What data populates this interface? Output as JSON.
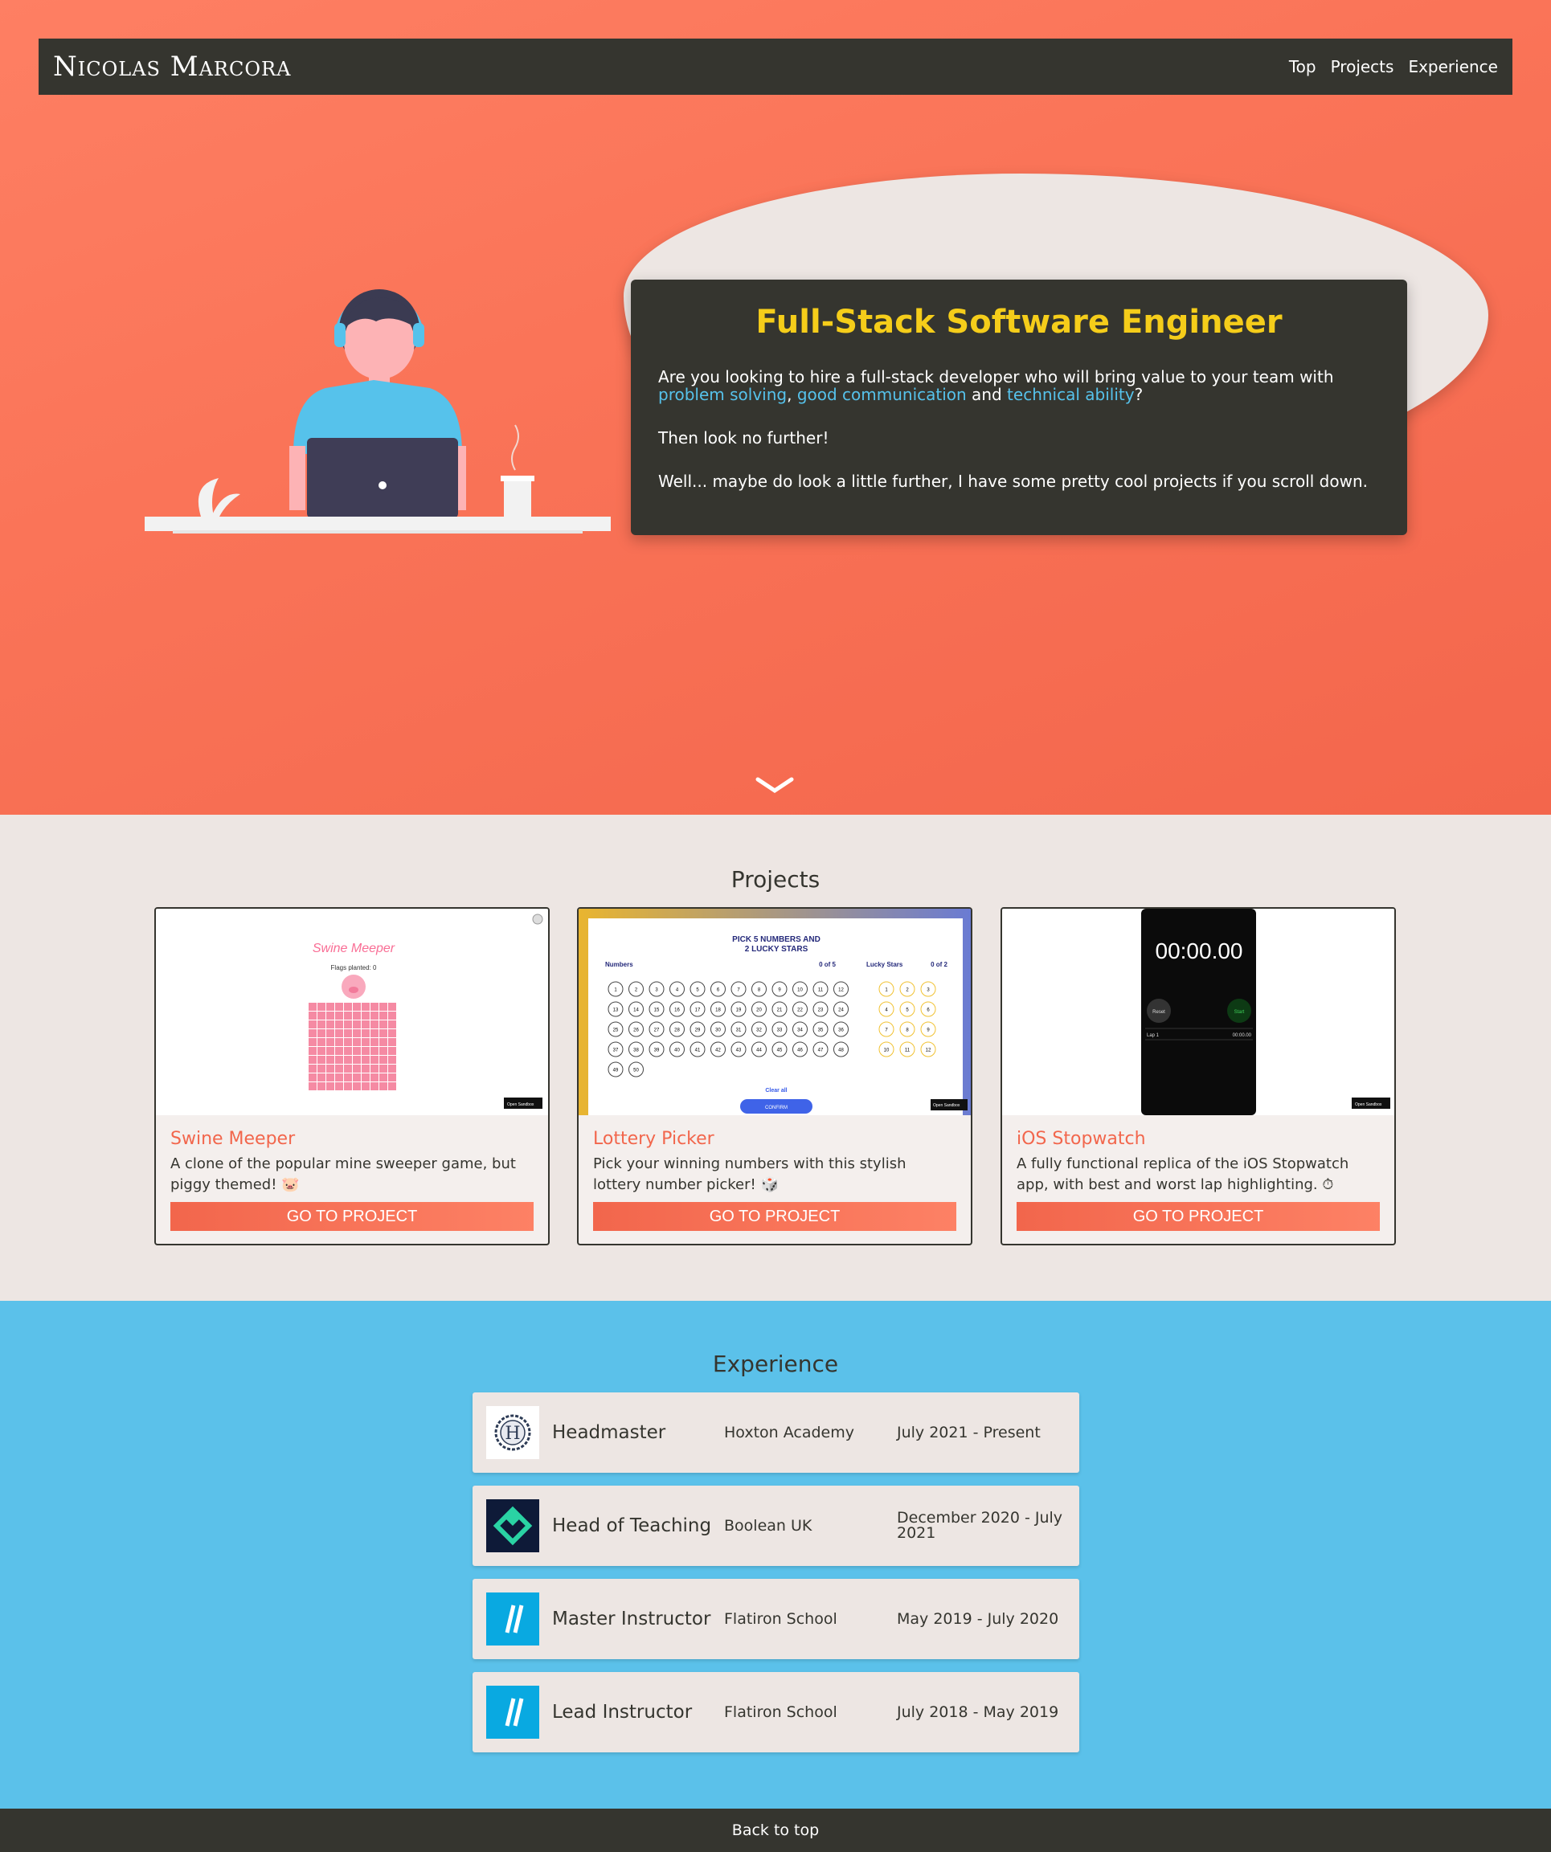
{
  "nav": {
    "brand": "Nicolas Marcora",
    "links": [
      "Top",
      "Projects",
      "Experience"
    ]
  },
  "hero": {
    "title": "Full-Stack Software Engineer",
    "p1_prefix": "Are you looking to hire a full-stack developer who will bring value to your team with ",
    "hl1": "problem solving",
    "sep1": ", ",
    "hl2": "good communication",
    "sep2": " and ",
    "hl3": "technical ability",
    "p1_suffix": "?",
    "p2": "Then look no further!",
    "p3": "Well... maybe do look a little further, I have some pretty cool projects if you scroll down.",
    "colors": {
      "title": "#f5cd1a",
      "highlight": "#56c2eb",
      "card": "#35352f"
    }
  },
  "projects": {
    "title": "Projects",
    "items": [
      {
        "name": "Swine Meeper",
        "desc": "A clone of the popular mine sweeper game, but piggy themed! 🐷",
        "button": "GO TO PROJECT",
        "thumb": {
          "title": "Swine Meeper",
          "subtitle": "Flags planted: 0",
          "badge": "Open Sandbox"
        }
      },
      {
        "name": "Lottery Picker",
        "desc": "Pick your winning numbers with this stylish lottery number picker! 🎲",
        "button": "GO TO PROJECT",
        "thumb": {
          "title1": "PICK 5 NUMBERS AND",
          "title2": "2 LUCKY STARS",
          "numbers_label": "Numbers",
          "numbers_count": "0 of 5",
          "stars_label": "Lucky Stars",
          "stars_count": "0 of 2",
          "clear": "Clear all",
          "confirm": "CONFIRM",
          "badge": "Open Sandbox"
        }
      },
      {
        "name": "iOS Stopwatch",
        "desc": "A fully functional replica of the iOS Stopwatch app, with best and worst lap highlighting. ⏱",
        "button": "GO TO PROJECT",
        "thumb": {
          "time": "00:00.00",
          "reset": "Reset",
          "start": "Start",
          "lap": "Lap 1",
          "lap_time": "00:00.00",
          "badge": "Open Sandbox"
        }
      }
    ]
  },
  "experience": {
    "title": "Experience",
    "items": [
      {
        "role": "Headmaster",
        "org": "Hoxton Academy",
        "dates": "July 2021 - Present",
        "logo": "hoxton-crest-icon"
      },
      {
        "role": "Head of Teaching",
        "org": "Boolean UK",
        "dates": "December 2020 - July 2021",
        "logo": "boolean-diamond-icon"
      },
      {
        "role": "Master Instructor",
        "org": "Flatiron School",
        "dates": "May 2019 - July 2020",
        "logo": "flatiron-slashes-icon"
      },
      {
        "role": "Lead Instructor",
        "org": "Flatiron School",
        "dates": "July 2018 - May 2019",
        "logo": "flatiron-slashes-icon"
      }
    ]
  },
  "footer": {
    "link": "Back to top"
  }
}
